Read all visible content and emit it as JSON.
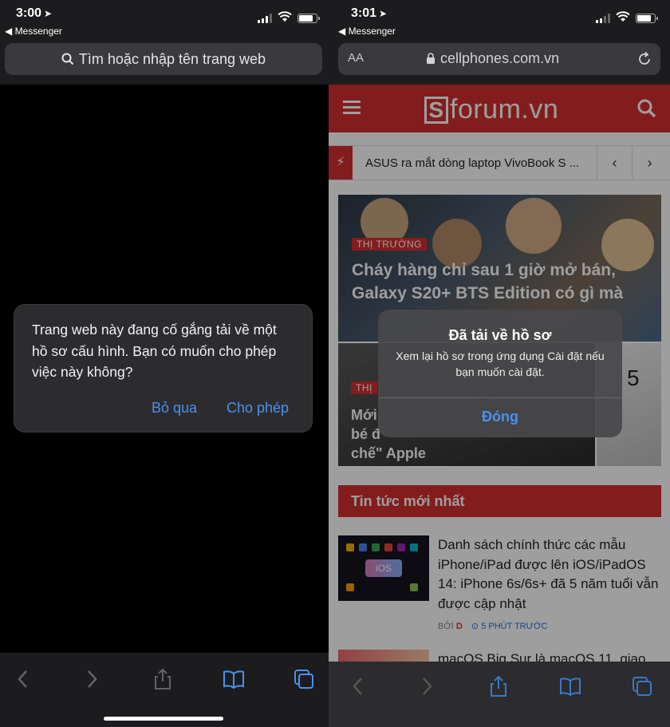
{
  "left": {
    "status": {
      "time": "3:00",
      "back_app": "◀ Messenger"
    },
    "url_bar": {
      "placeholder": "Tìm hoặc nhập tên trang web"
    },
    "alert": {
      "message": "Trang web này đang cố gắng tải về một hồ sơ cấu hình. Bạn có muốn cho phép việc này không?",
      "ignore_label": "Bỏ qua",
      "allow_label": "Cho phép"
    },
    "toolbar": {
      "icons": [
        "back-icon",
        "forward-icon",
        "share-icon",
        "bookmarks-icon",
        "tabs-icon"
      ]
    }
  },
  "right": {
    "status": {
      "time": "3:01",
      "back_app": "◀ Messenger"
    },
    "url_bar": {
      "aa": "AA",
      "host": "cellphones.com.vn"
    },
    "site": {
      "logo_s": "S",
      "logo_text": "forum.vn",
      "ticker_text": "ASUS ra mắt dòng laptop VivoBook S ...",
      "ticker_prev": "‹",
      "ticker_next": "›",
      "hero_tag": "THỊ TRƯỜNG",
      "hero_title": "Cháy hàng chỉ sau 1 giờ mở bán, Galaxy S20+ BTS Edition có gì mà",
      "card_tag": "THỊ",
      "card_title": "Mới\nbé đ\nchế\" Apple",
      "card_b_text": "5",
      "section_title": "Tin tức mới nhất",
      "news": [
        {
          "title": "Danh sách chính thức các mẫu iPhone/iPad được lên iOS/iPadOS 14: iPhone 6s/6s+ đã 5 năm tuổi vẫn được cập nhật",
          "thumb_label": "iOS",
          "by": "BỞI",
          "author": "D",
          "time": "5 PHÚT TRƯỚC"
        },
        {
          "title": "macOS Big Sur là macOS 11, giao"
        }
      ]
    },
    "alert": {
      "title": "Đã tải về hồ sơ",
      "message": "Xem lại hồ sơ trong ứng dụng Cài đặt nếu bạn muốn cài đặt.",
      "close_label": "Đóng"
    },
    "colors": {
      "brand_red": "#d32f2f",
      "ios_blue": "#4a90f0"
    }
  }
}
